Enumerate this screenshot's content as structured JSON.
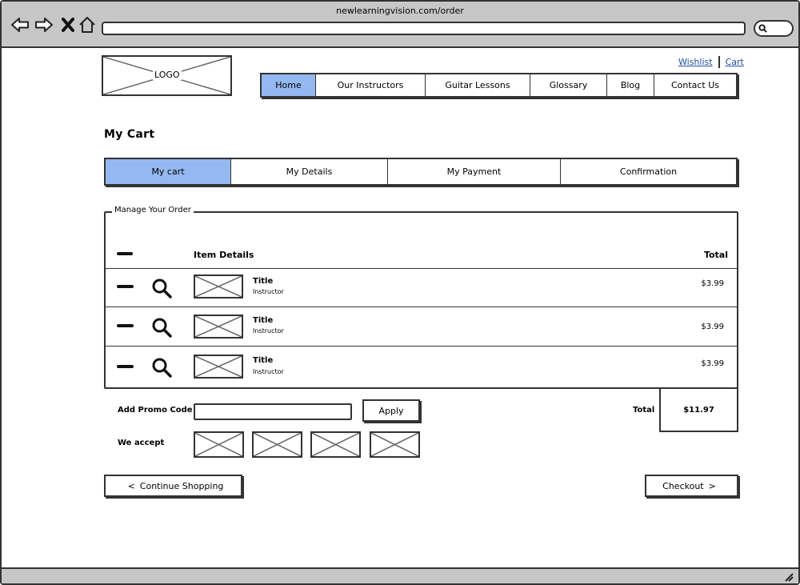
{
  "browser": {
    "url": "newlearningvision.com/order",
    "icons": [
      "back-arrow-icon",
      "forward-arrow-icon",
      "close-x-icon",
      "home-icon",
      "search-icon",
      "resize-grip-icon"
    ]
  },
  "logo": {
    "text": "LOGO"
  },
  "top_links": {
    "wishlist": "Wishlist",
    "cart": "Cart"
  },
  "nav": {
    "items": [
      {
        "label": "Home",
        "active": true
      },
      {
        "label": "Our Instructors",
        "active": false
      },
      {
        "label": "Guitar Lessons",
        "active": false
      },
      {
        "label": "Glossary",
        "active": false
      },
      {
        "label": "Blog",
        "active": false
      },
      {
        "label": "Contact Us",
        "active": false
      }
    ]
  },
  "page": {
    "title": "My Cart"
  },
  "steps": {
    "items": [
      {
        "label": "My cart",
        "active": true
      },
      {
        "label": "My Details",
        "active": false
      },
      {
        "label": "My Payment",
        "active": false
      },
      {
        "label": "Confirmation",
        "active": false
      }
    ]
  },
  "order": {
    "legend": "Manage Your Order",
    "header": {
      "details": "Item Details",
      "total": "Total"
    },
    "rows": [
      {
        "title": "Title",
        "subtitle": "Instructor",
        "price": "$3.99"
      },
      {
        "title": "Title",
        "subtitle": "Instructor",
        "price": "$3.99"
      },
      {
        "title": "Title",
        "subtitle": "Instructor",
        "price": "$3.99"
      }
    ]
  },
  "promo": {
    "label": "Add Promo Code",
    "value": "",
    "apply_label": "Apply"
  },
  "summary": {
    "total_label": "Total",
    "total_value": "$11.97"
  },
  "payment": {
    "label": "We accept"
  },
  "actions": {
    "continue_glyph": "<",
    "continue_label": "Continue Shopping",
    "checkout_label": "Checkout",
    "checkout_glyph": ">"
  },
  "colors": {
    "active_tab": "#94b8f0",
    "chrome": "#c7c7c7",
    "link": "#1f4fa3"
  }
}
